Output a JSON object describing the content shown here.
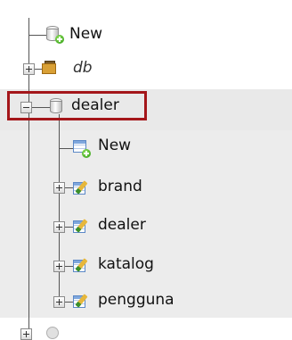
{
  "tree": {
    "top_new": {
      "label": "New"
    },
    "sample_db": {
      "label": "db"
    },
    "database": {
      "label": "dealer",
      "expanded": true,
      "selected": true,
      "children": {
        "new": {
          "label": "New"
        },
        "tables": [
          {
            "label": "brand"
          },
          {
            "label": "dealer"
          },
          {
            "label": "katalog"
          },
          {
            "label": "pengguna"
          }
        ]
      }
    }
  },
  "colors": {
    "selection_border": "#a4161a",
    "selected_background": "#e9e9e9"
  }
}
